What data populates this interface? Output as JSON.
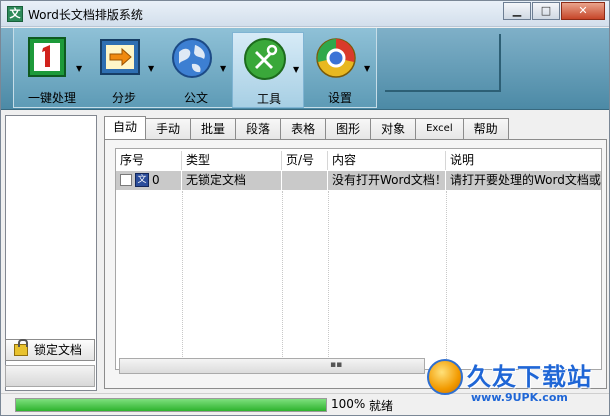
{
  "window": {
    "title": "Word长文档排版系统",
    "app_icon_glyph": "文",
    "controls": [
      "minimize-icon",
      "maximize-icon",
      "close-icon"
    ]
  },
  "toolbar": {
    "items": [
      {
        "label": "一键处理",
        "icon": "one-click-icon"
      },
      {
        "label": "分步",
        "icon": "step-icon"
      },
      {
        "label": "公文",
        "icon": "globe-icon"
      },
      {
        "label": "工具",
        "icon": "tools-icon",
        "active": true
      },
      {
        "label": "设置",
        "icon": "settings-icon"
      }
    ]
  },
  "left_panel": {
    "lock_button": "锁定文档"
  },
  "tabs": [
    "自动",
    "手动",
    "批量",
    "段落",
    "表格",
    "图形",
    "对象",
    "Excel",
    "帮助"
  ],
  "active_tab": "自动",
  "grid": {
    "columns": [
      "序号",
      "类型",
      "页/号",
      "内容",
      "说明"
    ],
    "rows": [
      {
        "seq": "0",
        "type": "无锁定文档",
        "page": "",
        "content": "没有打开Word文档！",
        "note": "请打开要处理的Word文档或"
      }
    ],
    "row_icon_glyph": "文"
  },
  "status": {
    "progress_percent": 100,
    "progress_text": "100%",
    "state": "就绪"
  },
  "watermark": {
    "title": "久友下载站",
    "url": "www.9UPK.com"
  },
  "colors": {
    "toolbar": "#5e9bb6",
    "progress": "#2db22d",
    "selected_row": "#c9c9c9",
    "watermark": "#1f66d6"
  }
}
